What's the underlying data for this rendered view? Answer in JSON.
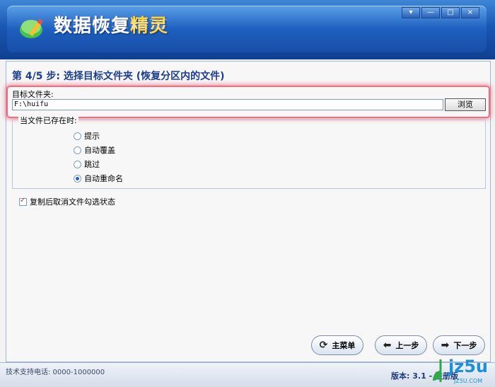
{
  "window": {
    "app_title_main": "数据恢复",
    "app_title_highlight": "精灵",
    "controls": [
      "▾",
      "—",
      "□",
      "×"
    ]
  },
  "step": {
    "title": "第 4/5 步: 选择目标文件夹 (恢复分区内的文件)"
  },
  "target": {
    "label": "目标文件夹:",
    "path": "F:\\huifu",
    "browse_label": "浏览"
  },
  "exists_group": {
    "legend": "当文件已存在时:",
    "options": [
      {
        "label": "提示",
        "selected": false
      },
      {
        "label": "自动覆盖",
        "selected": false
      },
      {
        "label": "跳过",
        "selected": false
      },
      {
        "label": "自动重命名",
        "selected": true
      }
    ]
  },
  "uncheck_option": {
    "label": "复制后取消文件勾选状态",
    "checked": true
  },
  "nav": {
    "main_menu": "主菜单",
    "prev": "上一步",
    "next": "下一步"
  },
  "status": {
    "left": "技术支持电话: 0000-1000000",
    "version": "版本: 3.1 - 注册版"
  },
  "watermark": {
    "text": "jz5u",
    "sub": "JZ5U.COM"
  },
  "colors": {
    "header": "#1f5fbf",
    "highlight_border": "#f16d7d",
    "title_text": "#1c3e8e"
  }
}
